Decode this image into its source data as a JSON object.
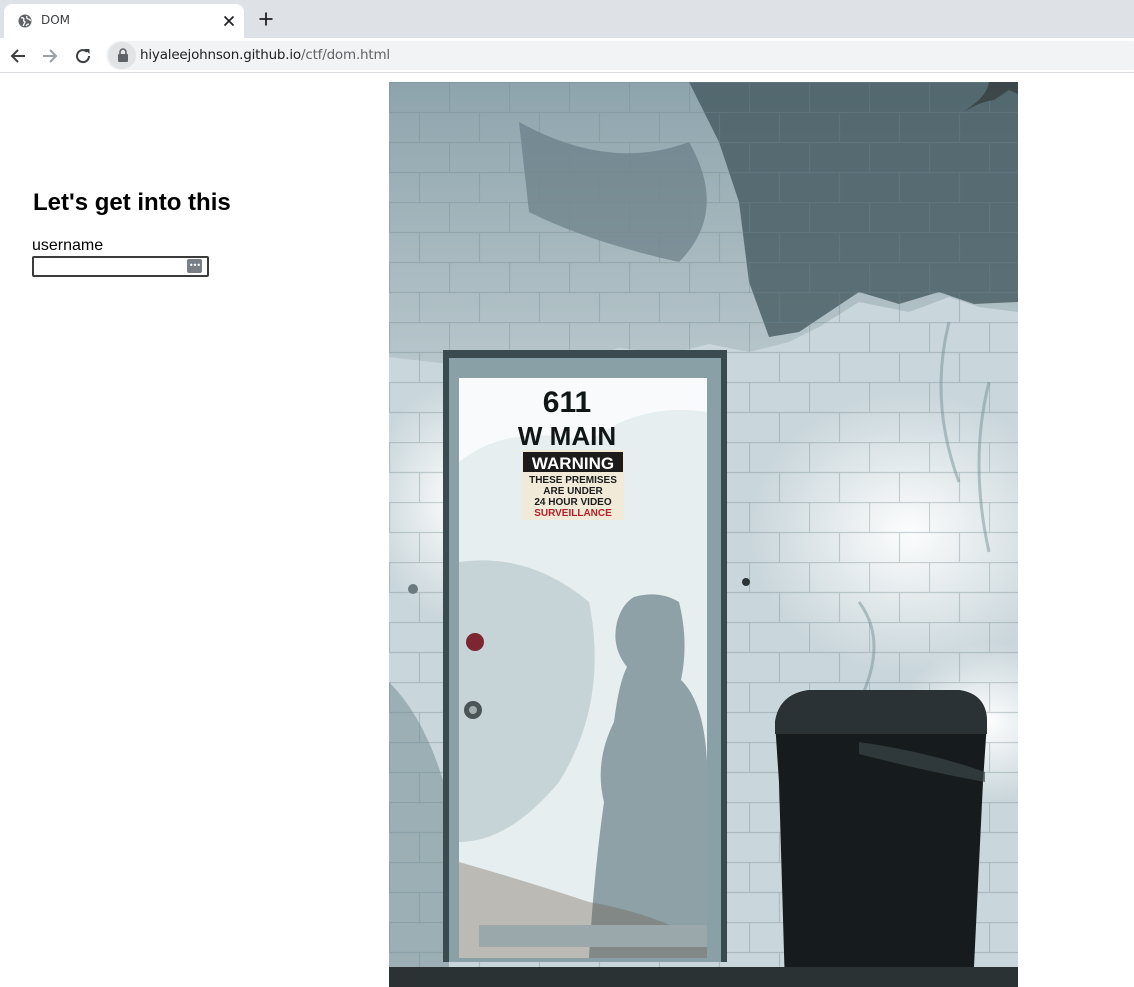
{
  "browser": {
    "tab": {
      "title": "DOM",
      "favicon": "globe-icon",
      "close_icon": "close-icon"
    },
    "new_tab_icon": "plus-icon",
    "nav": {
      "back_icon": "arrow-left-icon",
      "forward_icon": "arrow-right-icon",
      "reload_icon": "reload-icon"
    },
    "address": {
      "secure_icon": "lock-icon",
      "host": "hiyaleejohnson.github.io",
      "path": "/ctf/dom.html"
    }
  },
  "page": {
    "heading": "Let's get into this",
    "form": {
      "username_label": "username",
      "username_value": "",
      "password_manager_icon": "key-icon",
      "password_manager_glyph": "•••"
    },
    "photo": {
      "door_number": "611",
      "door_street": "W MAIN",
      "sign_title": "WARNING",
      "sign_lines": [
        "THESE PREMISES",
        "ARE UNDER",
        "24 HOUR VIDEO",
        "SURVEILLANCE"
      ]
    }
  },
  "colors": {
    "tabstrip": "#dee1e6",
    "omnibox": "#f1f3f4",
    "wall": "#cfd9dd",
    "wall_shadow": "#3f5a63",
    "door": "#e8eef0",
    "trash_can": "#161b1d",
    "sign_red": "#b3202a"
  }
}
